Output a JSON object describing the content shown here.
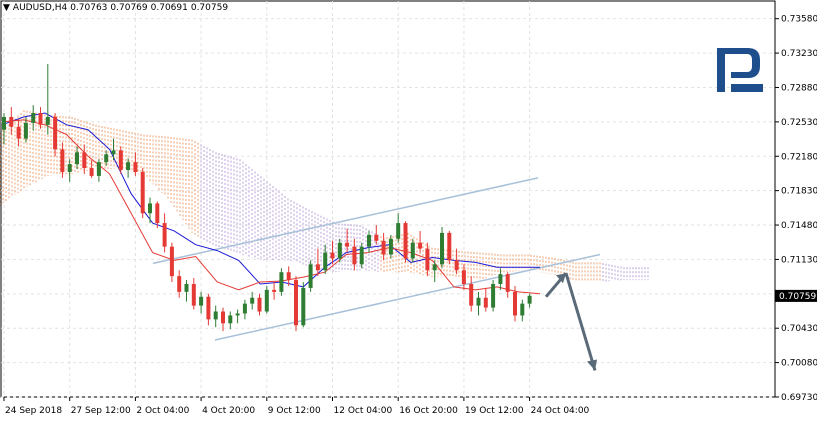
{
  "header": {
    "symbol": "AUDUSD,H4",
    "open": "0.70763",
    "high": "0.70769",
    "low": "0.70691",
    "close": "0.70759",
    "menu_icon": "triangle-down-icon"
  },
  "logo": {
    "name": "roboforex-logo-icon",
    "color": "#1f4e8c"
  },
  "colors": {
    "bull": "#2e7d32",
    "bear": "#e53935",
    "kijun": "#1a1ad6",
    "tenkan": "#e53935",
    "cloud_orange": "#f0a070",
    "cloud_violet": "#b8a0d8",
    "channel": "#a8c0d8",
    "arrow": "#5a6a78",
    "grid": "#e2e2e2",
    "price_badge_bg": "#000000",
    "price_badge_fg": "#ffffff"
  },
  "chart_data": {
    "type": "candlestick",
    "title": "AUDUSD,H4",
    "ylim": [
      0.6973,
      0.7376
    ],
    "y_ticks": [
      "0.73580",
      "0.73230",
      "0.72880",
      "0.72530",
      "0.72180",
      "0.71830",
      "0.71480",
      "0.71130",
      "0.70780",
      "0.70430",
      "0.70080",
      "0.69730"
    ],
    "x_ticks": [
      "24 Sep 2018",
      "27 Sep 12:00",
      "2 Oct 04:00",
      "4 Oct 20:00",
      "9 Oct 12:00",
      "12 Oct 04:00",
      "16 Oct 20:00",
      "19 Oct 12:00",
      "24 Oct 04:00"
    ],
    "current_price": "0.70759",
    "grid": true,
    "series": [
      {
        "name": "",
        "kind": "tenkan",
        "values": [
          0.7253,
          0.7255,
          0.725,
          0.724,
          0.7218,
          0.72,
          0.716,
          0.712,
          0.7112,
          0.7116,
          0.709,
          0.7082,
          0.709,
          0.7091,
          0.7095,
          0.71,
          0.7118,
          0.712,
          0.7125,
          0.712,
          0.7112,
          0.7085,
          0.7082,
          0.7085,
          0.708,
          0.7078
        ]
      },
      {
        "name": "",
        "kind": "kijun",
        "values": [
          0.725,
          0.7258,
          0.7262,
          0.725,
          0.7245,
          0.7225,
          0.718,
          0.715,
          0.7142,
          0.7128,
          0.7122,
          0.7112,
          0.7088,
          0.709,
          0.7085,
          0.7105,
          0.712,
          0.7125,
          0.7128,
          0.711,
          0.7115,
          0.7112,
          0.711,
          0.7105,
          0.7105,
          0.7105
        ]
      },
      {
        "name": "",
        "kind": "cloud_upper",
        "values": [
          0.7242,
          0.7265,
          0.726,
          0.7258,
          0.725,
          0.7245,
          0.724,
          0.7238,
          0.7235,
          0.7222,
          0.7215,
          0.7195,
          0.7175,
          0.7162,
          0.715,
          0.7148,
          0.7135,
          0.714,
          0.7125,
          0.7122,
          0.712,
          0.7118,
          0.7118,
          0.7115,
          0.711,
          0.711,
          0.7105,
          0.7105
        ]
      },
      {
        "name": "",
        "kind": "cloud_lower",
        "values": [
          0.7168,
          0.7185,
          0.7198,
          0.72,
          0.7205,
          0.7205,
          0.7198,
          0.7175,
          0.714,
          0.7125,
          0.7118,
          0.7112,
          0.7112,
          0.7105,
          0.71,
          0.7102,
          0.71,
          0.71,
          0.7095,
          0.7095,
          0.7092,
          0.71,
          0.7102,
          0.7098,
          0.709,
          0.709,
          0.7092,
          0.7092
        ]
      },
      {
        "name": "",
        "kind": "channel_upper",
        "from": 0.7109,
        "to": 0.7196
      },
      {
        "name": "",
        "kind": "channel_lower",
        "from": 0.7031,
        "to": 0.7118
      },
      {
        "name": "",
        "kind": "forecast_arrow",
        "from": 0.7075,
        "mid": 0.7099,
        "to": 0.7
      }
    ],
    "candles": [
      [
        0.7245,
        0.7262,
        0.723,
        0.7258
      ],
      [
        0.7258,
        0.7268,
        0.724,
        0.7248
      ],
      [
        0.7248,
        0.7256,
        0.7228,
        0.7236
      ],
      [
        0.7236,
        0.7258,
        0.7232,
        0.7252
      ],
      [
        0.7252,
        0.727,
        0.7244,
        0.7262
      ],
      [
        0.7262,
        0.7268,
        0.7246,
        0.725
      ],
      [
        0.725,
        0.7312,
        0.724,
        0.7258
      ],
      [
        0.7258,
        0.7262,
        0.7218,
        0.7225
      ],
      [
        0.7225,
        0.7232,
        0.7196,
        0.7202
      ],
      [
        0.7202,
        0.7215,
        0.7192,
        0.721
      ],
      [
        0.721,
        0.7228,
        0.7205,
        0.7222
      ],
      [
        0.7222,
        0.723,
        0.72,
        0.7206
      ],
      [
        0.7206,
        0.7214,
        0.7196,
        0.7198
      ],
      [
        0.7198,
        0.7215,
        0.7192,
        0.7212
      ],
      [
        0.7212,
        0.7224,
        0.7208,
        0.722
      ],
      [
        0.722,
        0.7236,
        0.7214,
        0.7224
      ],
      [
        0.7224,
        0.7228,
        0.72,
        0.7204
      ],
      [
        0.7204,
        0.7216,
        0.7196,
        0.7212
      ],
      [
        0.7212,
        0.7222,
        0.7198,
        0.7202
      ],
      [
        0.7202,
        0.7206,
        0.7155,
        0.716
      ],
      [
        0.716,
        0.7176,
        0.715,
        0.717
      ],
      [
        0.717,
        0.7172,
        0.7145,
        0.715
      ],
      [
        0.715,
        0.716,
        0.712,
        0.7126
      ],
      [
        0.7126,
        0.713,
        0.709,
        0.7096
      ],
      [
        0.7096,
        0.7102,
        0.7074,
        0.708
      ],
      [
        0.708,
        0.7092,
        0.707,
        0.7088
      ],
      [
        0.7088,
        0.7094,
        0.7062,
        0.7066
      ],
      [
        0.7066,
        0.708,
        0.7058,
        0.7075
      ],
      [
        0.7075,
        0.7078,
        0.7046,
        0.7052
      ],
      [
        0.7052,
        0.7066,
        0.7044,
        0.706
      ],
      [
        0.706,
        0.7064,
        0.704,
        0.7048
      ],
      [
        0.7048,
        0.706,
        0.7042,
        0.7056
      ],
      [
        0.7056,
        0.7062,
        0.7048,
        0.7058
      ],
      [
        0.7058,
        0.7072,
        0.7052,
        0.7068
      ],
      [
        0.7068,
        0.708,
        0.7062,
        0.7074
      ],
      [
        0.7074,
        0.7078,
        0.7056,
        0.706
      ],
      [
        0.706,
        0.7086,
        0.7058,
        0.7082
      ],
      [
        0.7082,
        0.709,
        0.7072,
        0.708
      ],
      [
        0.708,
        0.7104,
        0.7076,
        0.71
      ],
      [
        0.71,
        0.7106,
        0.7086,
        0.7092
      ],
      [
        0.7092,
        0.7096,
        0.704,
        0.7046
      ],
      [
        0.7046,
        0.709,
        0.7044,
        0.7084
      ],
      [
        0.7084,
        0.7112,
        0.708,
        0.7108
      ],
      [
        0.7108,
        0.7124,
        0.7096,
        0.7102
      ],
      [
        0.7102,
        0.7128,
        0.7098,
        0.712
      ],
      [
        0.712,
        0.7132,
        0.7108,
        0.7114
      ],
      [
        0.7114,
        0.7134,
        0.711,
        0.713
      ],
      [
        0.713,
        0.7144,
        0.712,
        0.7126
      ],
      [
        0.7126,
        0.7134,
        0.7102,
        0.7108
      ],
      [
        0.7108,
        0.713,
        0.7104,
        0.7126
      ],
      [
        0.7126,
        0.7142,
        0.712,
        0.7138
      ],
      [
        0.7138,
        0.7148,
        0.7128,
        0.7132
      ],
      [
        0.7132,
        0.714,
        0.7112,
        0.7118
      ],
      [
        0.7118,
        0.7138,
        0.7114,
        0.7134
      ],
      [
        0.7134,
        0.716,
        0.713,
        0.715
      ],
      [
        0.715,
        0.7152,
        0.711,
        0.7114
      ],
      [
        0.7114,
        0.7134,
        0.711,
        0.713
      ],
      [
        0.713,
        0.7142,
        0.712,
        0.7124
      ],
      [
        0.7124,
        0.713,
        0.7096,
        0.7102
      ],
      [
        0.7102,
        0.7112,
        0.709,
        0.7108
      ],
      [
        0.7108,
        0.7146,
        0.7104,
        0.714
      ],
      [
        0.714,
        0.7142,
        0.7108,
        0.7112
      ],
      [
        0.7112,
        0.7124,
        0.7098,
        0.7102
      ],
      [
        0.7102,
        0.7108,
        0.7082,
        0.7088
      ],
      [
        0.7088,
        0.7096,
        0.706,
        0.7066
      ],
      [
        0.7066,
        0.708,
        0.7056,
        0.7074
      ],
      [
        0.7074,
        0.7084,
        0.706,
        0.7064
      ],
      [
        0.7064,
        0.7092,
        0.706,
        0.7088
      ],
      [
        0.7088,
        0.7104,
        0.7082,
        0.7098
      ],
      [
        0.7098,
        0.71,
        0.7074,
        0.708
      ],
      [
        0.708,
        0.7086,
        0.705,
        0.7056
      ],
      [
        0.7056,
        0.7072,
        0.705,
        0.7068
      ],
      [
        0.7068,
        0.7078,
        0.7064,
        0.7076
      ]
    ]
  }
}
